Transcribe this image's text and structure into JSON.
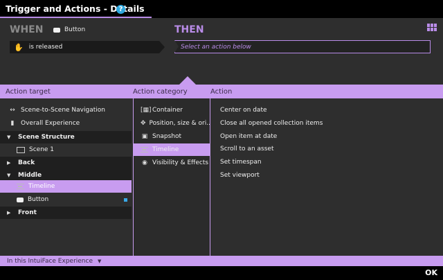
{
  "window": {
    "title": "Trigger and Actions - Details",
    "help_icon": "?"
  },
  "when": {
    "label": "WHEN",
    "source": "Button",
    "trigger": "is released"
  },
  "then": {
    "label": "THEN",
    "action_placeholder": "Select an action below"
  },
  "headers": {
    "target": "Action target",
    "category": "Action category",
    "action": "Action"
  },
  "targets": [
    {
      "label": "Scene-to-Scene Navigation",
      "icon": "navigation-arrows-icon"
    },
    {
      "label": "Overall Experience",
      "icon": "book-icon"
    },
    {
      "label": "Scene Structure",
      "group": true
    },
    {
      "label": "Scene 1",
      "icon": "scene-icon"
    },
    {
      "label": "Back",
      "group": true
    },
    {
      "label": "Middle",
      "group": true
    },
    {
      "label": "Timeline",
      "icon": "timeline-icon",
      "selected": true
    },
    {
      "label": "Button",
      "icon": "button-icon"
    },
    {
      "label": "Front",
      "group": true
    }
  ],
  "categories": [
    {
      "label": "Container",
      "icon": "container-icon"
    },
    {
      "label": "Position, size & ori...",
      "icon": "move-icon"
    },
    {
      "label": "Snapshot",
      "icon": "snapshot-icon"
    },
    {
      "label": "Timeline",
      "icon": "timeline-icon",
      "selected": true
    },
    {
      "label": "Visibility & Effects",
      "icon": "eye-icon"
    }
  ],
  "actions": [
    "Center on date",
    "Close all opened collection items",
    "Open item at date",
    "Scroll to an asset",
    "Set timespan",
    "Set viewport"
  ],
  "footer": {
    "scope": "In this IntuiFace Experience"
  },
  "ok": "OK",
  "colors": {
    "accent": "#c89cf0",
    "then": "#b98ce8",
    "help": "#2fa8df",
    "badge": "#39a8e6"
  }
}
